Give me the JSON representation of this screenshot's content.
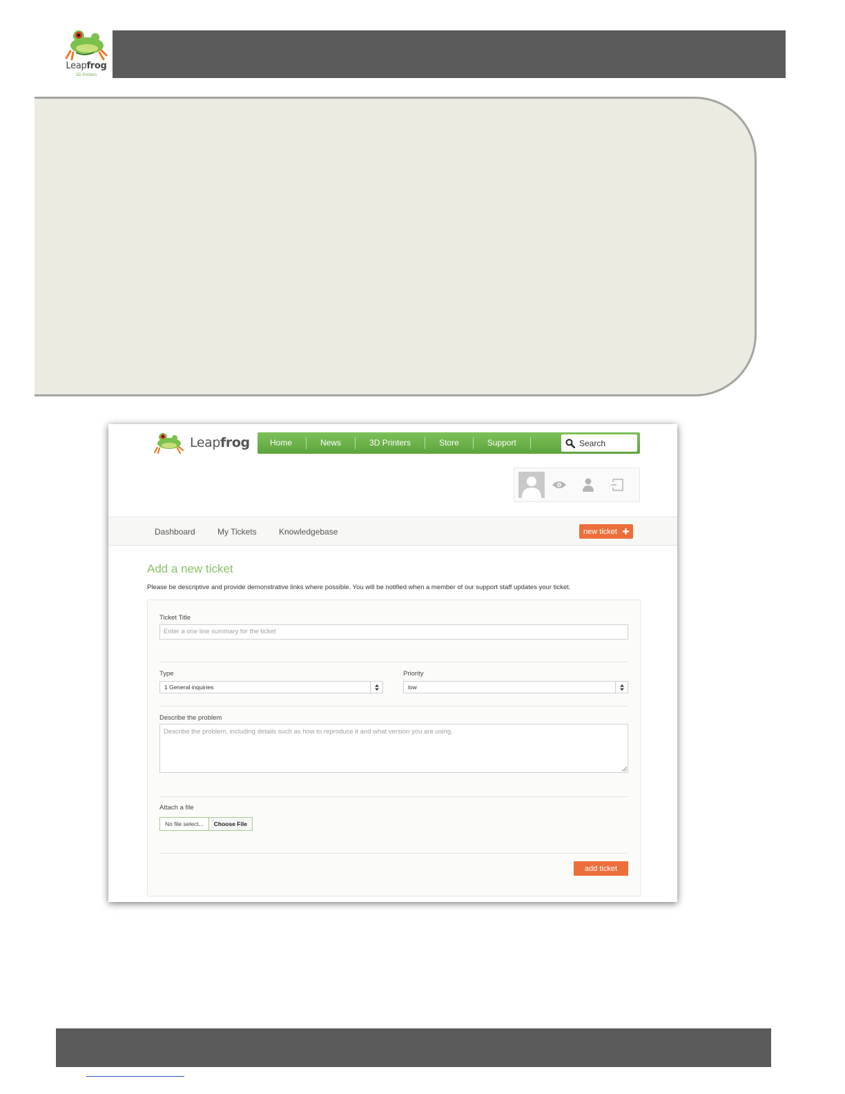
{
  "doc": {
    "logo_word_light": "Leap",
    "logo_word_bold": "frog",
    "logo_subtitle": "3D Printers"
  },
  "site": {
    "logo_word_light": "Leap",
    "logo_word_bold": "frog",
    "nav": [
      "Home",
      "News",
      "3D Printers",
      "Store",
      "Support"
    ],
    "search_label": "Search",
    "subnav": [
      "Dashboard",
      "My Tickets",
      "Knowledgebase"
    ],
    "new_ticket_label": "new ticket"
  },
  "form": {
    "heading": "Add a new ticket",
    "description": "Please be descriptive and provide demonstrative links where possible. You will be notified when a member of our support staff updates your ticket.",
    "title_label": "Ticket Title",
    "title_placeholder": "Enter a one line summary for the ticket",
    "type_label": "Type",
    "type_value": "1 General inquiries",
    "priority_label": "Priority",
    "priority_value": "low",
    "problem_label": "Describe the problem",
    "problem_placeholder": "Describe the problem, including details such as how to reproduce it and what version you are using.",
    "attach_label": "Attach a file",
    "file_name": "No file select...",
    "choose_file_label": "Choose File",
    "submit_label": "add ticket"
  },
  "colors": {
    "accent_green": "#6cb24a",
    "accent_orange": "#ee6e3a",
    "header_bar": "#5a5a5a",
    "panel_beige": "#ecebe1"
  },
  "icons": [
    "frog-logo-icon",
    "search-icon",
    "avatar-icon",
    "eye-icon",
    "user-icon",
    "logout-icon",
    "plus-icon",
    "resize-handle-icon"
  ]
}
